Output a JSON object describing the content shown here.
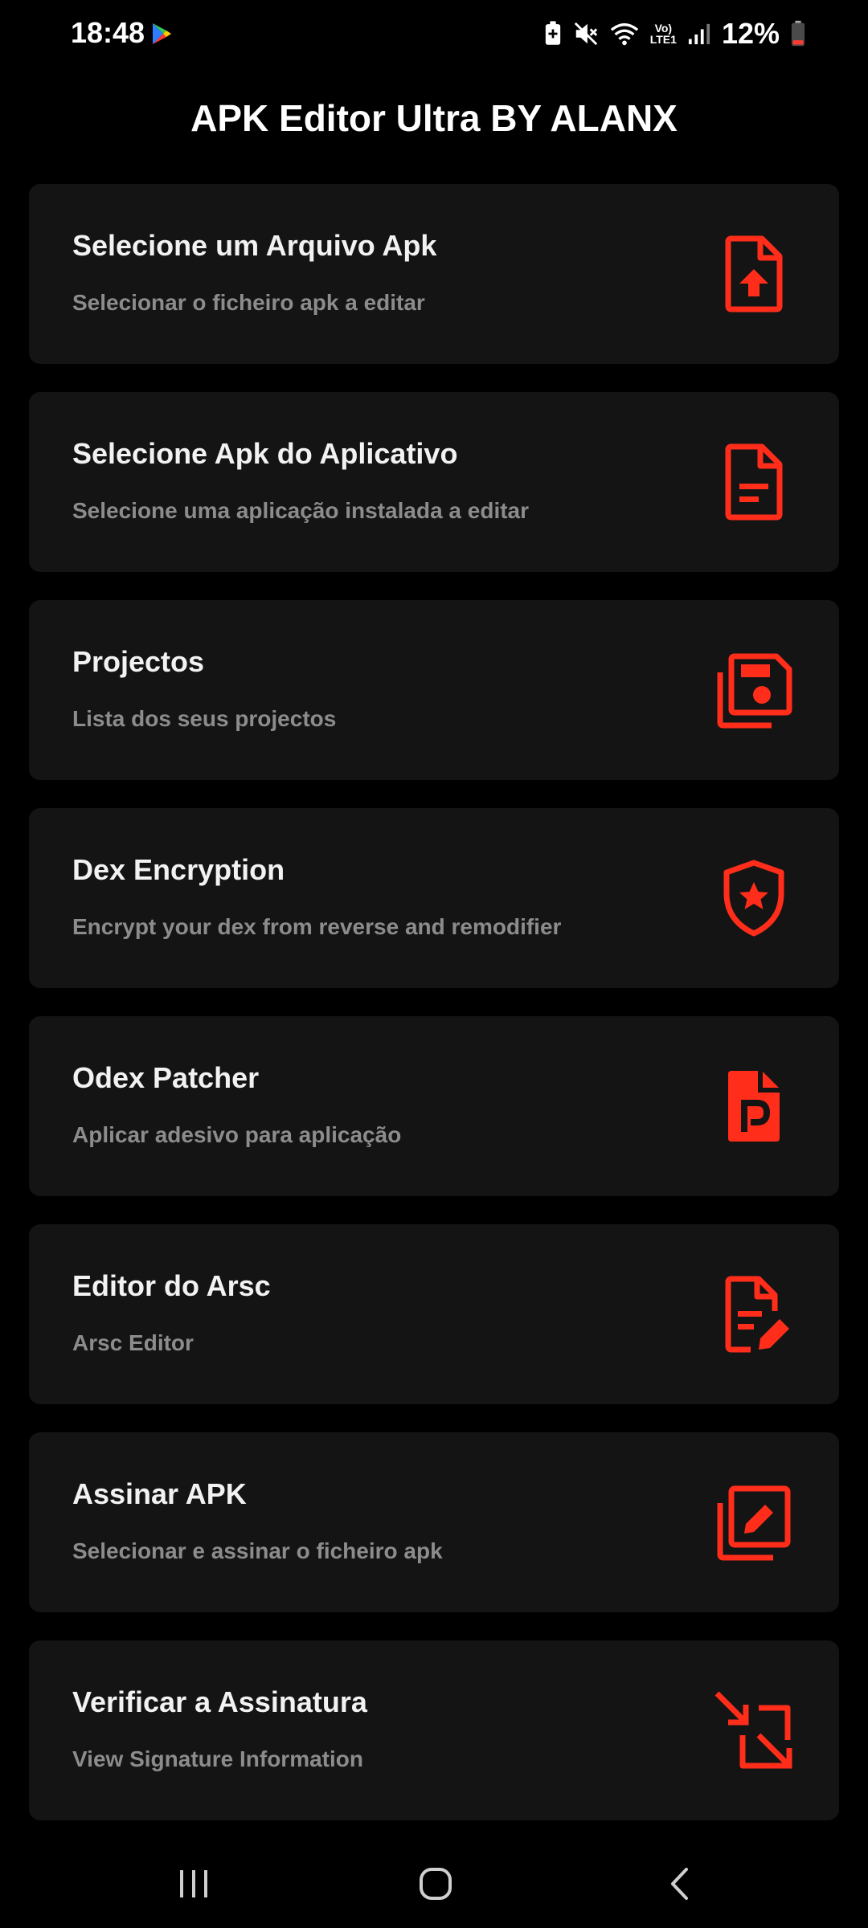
{
  "status_bar": {
    "time": "18:48",
    "battery_percent": "12%",
    "volte_line1": "Vo)",
    "volte_line2": "LTE1",
    "icons": [
      "play-store-icon",
      "battery-saver-icon",
      "mute-icon",
      "wifi-icon",
      "volte-icon",
      "signal-icon",
      "battery-icon"
    ]
  },
  "header": {
    "title": "APK Editor Ultra BY ALANX"
  },
  "accent_color": "#ff2d1a",
  "menu": {
    "items": [
      {
        "title": "Selecione um Arquivo Apk",
        "subtitle": "Selecionar o ficheiro apk a editar",
        "icon": "file-upload-icon"
      },
      {
        "title": "Selecione Apk do Aplicativo",
        "subtitle": "Selecione uma aplicação instalada a editar",
        "icon": "document-icon"
      },
      {
        "title": "Projectos",
        "subtitle": "Lista dos seus projectos",
        "icon": "save-projects-icon"
      },
      {
        "title": "Dex Encryption",
        "subtitle": "Encrypt your dex from reverse and remodifier",
        "icon": "shield-star-icon"
      },
      {
        "title": "Odex Patcher",
        "subtitle": "Aplicar adesivo para aplicação",
        "icon": "file-p-icon"
      },
      {
        "title": "Editor do Arsc",
        "subtitle": "Arsc Editor",
        "icon": "file-edit-icon"
      },
      {
        "title": "Assinar APK",
        "subtitle": "Selecionar e assinar o ficheiro apk",
        "icon": "sign-edit-icon"
      },
      {
        "title": "Verificar a Assinatura",
        "subtitle": "View Signature Information",
        "icon": "arrows-diagonal-icon"
      }
    ]
  },
  "nav_bar": {
    "buttons": [
      "recent-apps-icon",
      "home-icon",
      "back-icon"
    ]
  }
}
